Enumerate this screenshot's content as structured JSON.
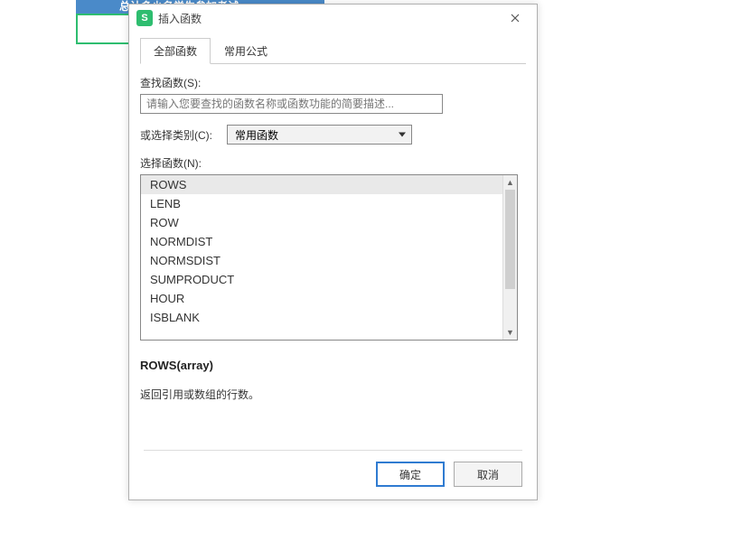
{
  "background": {
    "blue_strip_text": "总计多少名学生参加考试",
    "green_box_value": ""
  },
  "dialog": {
    "icon_letter": "S",
    "title": "插入函数",
    "tabs": [
      {
        "label": "全部函数",
        "active": true
      },
      {
        "label": "常用公式",
        "active": false
      }
    ],
    "search": {
      "label": "查找函数(S):",
      "placeholder": "请输入您要查找的函数名称或函数功能的简要描述..."
    },
    "category": {
      "label": "或选择类别(C):",
      "selected": "常用函数"
    },
    "select_label": "选择函数(N):",
    "functions": [
      "ROWS",
      "LENB",
      "ROW",
      "NORMDIST",
      "NORMSDIST",
      "SUMPRODUCT",
      "HOUR",
      "ISBLANK"
    ],
    "selected_index": 0,
    "syntax": "ROWS(array)",
    "description": "返回引用或数组的行数。",
    "buttons": {
      "ok": "确定",
      "cancel": "取消"
    }
  }
}
